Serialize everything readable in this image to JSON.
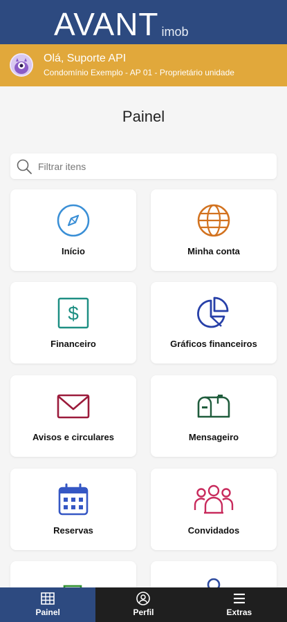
{
  "header": {
    "logo_main": "AVANT",
    "logo_sub": "imob"
  },
  "user": {
    "greeting": "Olá, Suporte API",
    "details": "Condomínio Exemplo - AP 01 - Proprietário unidade"
  },
  "page": {
    "title": "Painel"
  },
  "search": {
    "placeholder": "Filtrar itens",
    "value": ""
  },
  "cards": [
    {
      "label": "Início",
      "icon": "compass-icon",
      "color": "#3a8fd6"
    },
    {
      "label": "Minha conta",
      "icon": "globe-icon",
      "color": "#d2721f"
    },
    {
      "label": "Financeiro",
      "icon": "dollar-icon",
      "color": "#1e8f83"
    },
    {
      "label": "Gráficos financeiros",
      "icon": "pie-chart-icon",
      "color": "#2740a8"
    },
    {
      "label": "Avisos e circulares",
      "icon": "envelope-icon",
      "color": "#9b1b3b"
    },
    {
      "label": "Mensageiro",
      "icon": "mailbox-icon",
      "color": "#1f5c3c"
    },
    {
      "label": "Reservas",
      "icon": "calendar-icon",
      "color": "#3557c4"
    },
    {
      "label": "Convidados",
      "icon": "users-icon",
      "color": "#c82a5c"
    },
    {
      "label": "",
      "icon": "truck-icon",
      "color": "#2e8f2e"
    },
    {
      "label": "",
      "icon": "user-icon",
      "color": "#2d4a9e"
    }
  ],
  "bottom_nav": [
    {
      "label": "Painel",
      "icon": "grid-icon",
      "active": true
    },
    {
      "label": "Perfil",
      "icon": "profile-icon",
      "active": false
    },
    {
      "label": "Extras",
      "icon": "menu-icon",
      "active": false
    }
  ],
  "colors": {
    "topbar": "#2d4a80",
    "userbar": "#e1a83b",
    "bottom_nav": "#1f1f1f",
    "active_nav": "#2d4a80"
  }
}
